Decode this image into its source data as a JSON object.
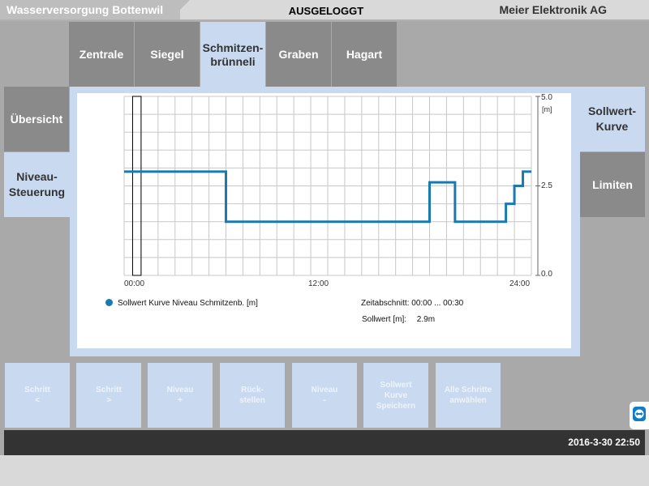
{
  "header": {
    "left_title": "Wasserversorgung Bottenwil",
    "center_status": "AUSGELOGGT",
    "right_title": "Meier Elektronik AG"
  },
  "tabs": [
    {
      "label": "Zentrale",
      "active": false
    },
    {
      "label": "Siegel",
      "active": false
    },
    {
      "label": "Schmitzen-\nbrünneli",
      "active": true
    },
    {
      "label": "Graben",
      "active": false
    },
    {
      "label": "Hagart",
      "active": false
    }
  ],
  "left_nav": [
    {
      "label": "Übersicht",
      "active": false
    },
    {
      "label": "Niveau-\nSteuerung",
      "active": true
    }
  ],
  "right_nav": [
    {
      "label": "Sollwert-\nKurve",
      "active": true
    },
    {
      "label": "Limiten",
      "active": false
    }
  ],
  "chart_data": {
    "type": "line",
    "x_ticks": [
      "00:00",
      "12:00",
      "24:00"
    ],
    "y_ticks": [
      "0.0",
      "2.5",
      "5.0"
    ],
    "y_unit": "[m]",
    "ylim": [
      0,
      5
    ],
    "xlim": [
      0,
      24
    ],
    "grid": true,
    "series": [
      {
        "name": "Sollwert Kurve Niveau Schmitzenb. [m]",
        "color": "#1a7ab0",
        "step": true,
        "points": [
          [
            0,
            2.9
          ],
          [
            6,
            2.9
          ],
          [
            6,
            1.5
          ],
          [
            18,
            1.5
          ],
          [
            18,
            2.6
          ],
          [
            19.5,
            2.6
          ],
          [
            19.5,
            1.5
          ],
          [
            22.5,
            1.5
          ],
          [
            22.5,
            2.0
          ],
          [
            23,
            2.0
          ],
          [
            23,
            2.5
          ],
          [
            23.5,
            2.5
          ],
          [
            23.5,
            2.9
          ],
          [
            24,
            2.9
          ]
        ]
      }
    ],
    "selection": {
      "start": 0.5,
      "end": 1.0
    }
  },
  "info": {
    "zeitabschnitt_label": "Zeitabschnitt:",
    "zeitabschnitt_value": "00:00 ... 00:30",
    "sollwert_label": "Sollwert [m]:",
    "sollwert_value": "2.9m"
  },
  "buttons": [
    {
      "line1": "Schritt",
      "line2": "<"
    },
    {
      "line1": "Schritt",
      "line2": ">"
    },
    {
      "line1": "Niveau",
      "line2": "+"
    },
    {
      "line1": "Rück-",
      "line2": "stellen"
    },
    {
      "line1": "Niveau",
      "line2": "-"
    },
    {
      "line1": "Sollwert\nKurve",
      "line2": "Speichern"
    },
    {
      "line1": "Alle Schritte",
      "line2": "anwählen"
    }
  ],
  "footer": {
    "datetime": "2016-3-30 22:50"
  },
  "icons": {
    "remote_support": "teamviewer-icon"
  }
}
